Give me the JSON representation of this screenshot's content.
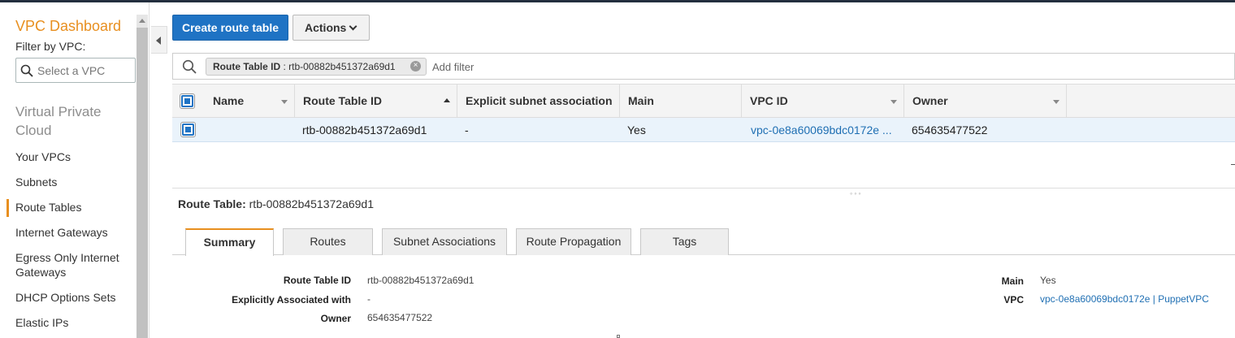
{
  "sidebar": {
    "title": "VPC Dashboard",
    "filter_label": "Filter by VPC:",
    "select_placeholder": "Select a VPC",
    "section": "Virtual Private Cloud",
    "items": [
      {
        "label": "Your VPCs"
      },
      {
        "label": "Subnets"
      },
      {
        "label": "Route Tables"
      },
      {
        "label": "Internet Gateways"
      },
      {
        "label": "Egress Only Internet Gateways"
      },
      {
        "label": "DHCP Options Sets"
      },
      {
        "label": "Elastic IPs"
      }
    ],
    "active_item": "Route Tables"
  },
  "toolbar": {
    "create_label": "Create route table",
    "actions_label": "Actions"
  },
  "filter": {
    "chip_key": "Route Table ID",
    "chip_value": ": rtb-00882b451372a69d1",
    "add_placeholder": "Add filter"
  },
  "table": {
    "columns": [
      "Name",
      "Route Table ID",
      "Explicit subnet association",
      "Main",
      "VPC ID",
      "Owner"
    ],
    "rows": [
      {
        "name": "",
        "route_table_id": "rtb-00882b451372a69d1",
        "explicit_subnet": "-",
        "main": "Yes",
        "vpc_id": "vpc-0e8a60069bdc0172e ...",
        "owner": "654635477522"
      }
    ]
  },
  "detail": {
    "label": "Route Table:",
    "value": "rtb-00882b451372a69d1",
    "tabs": [
      "Summary",
      "Routes",
      "Subnet Associations",
      "Route Propagation",
      "Tags"
    ],
    "active_tab": "Summary",
    "fields_left": [
      {
        "label": "Route Table ID",
        "value": "rtb-00882b451372a69d1"
      },
      {
        "label": "Explicitly Associated with",
        "value": "-"
      },
      {
        "label": "Owner",
        "value": "654635477522"
      }
    ],
    "fields_right": [
      {
        "label": "Main",
        "value": "Yes"
      },
      {
        "label": "VPC",
        "value": "vpc-0e8a60069bdc0172e | PuppetVPC"
      }
    ]
  },
  "colors": {
    "accent": "#e88f1f",
    "primary": "#1f73c4",
    "link": "#1f6fb3"
  }
}
